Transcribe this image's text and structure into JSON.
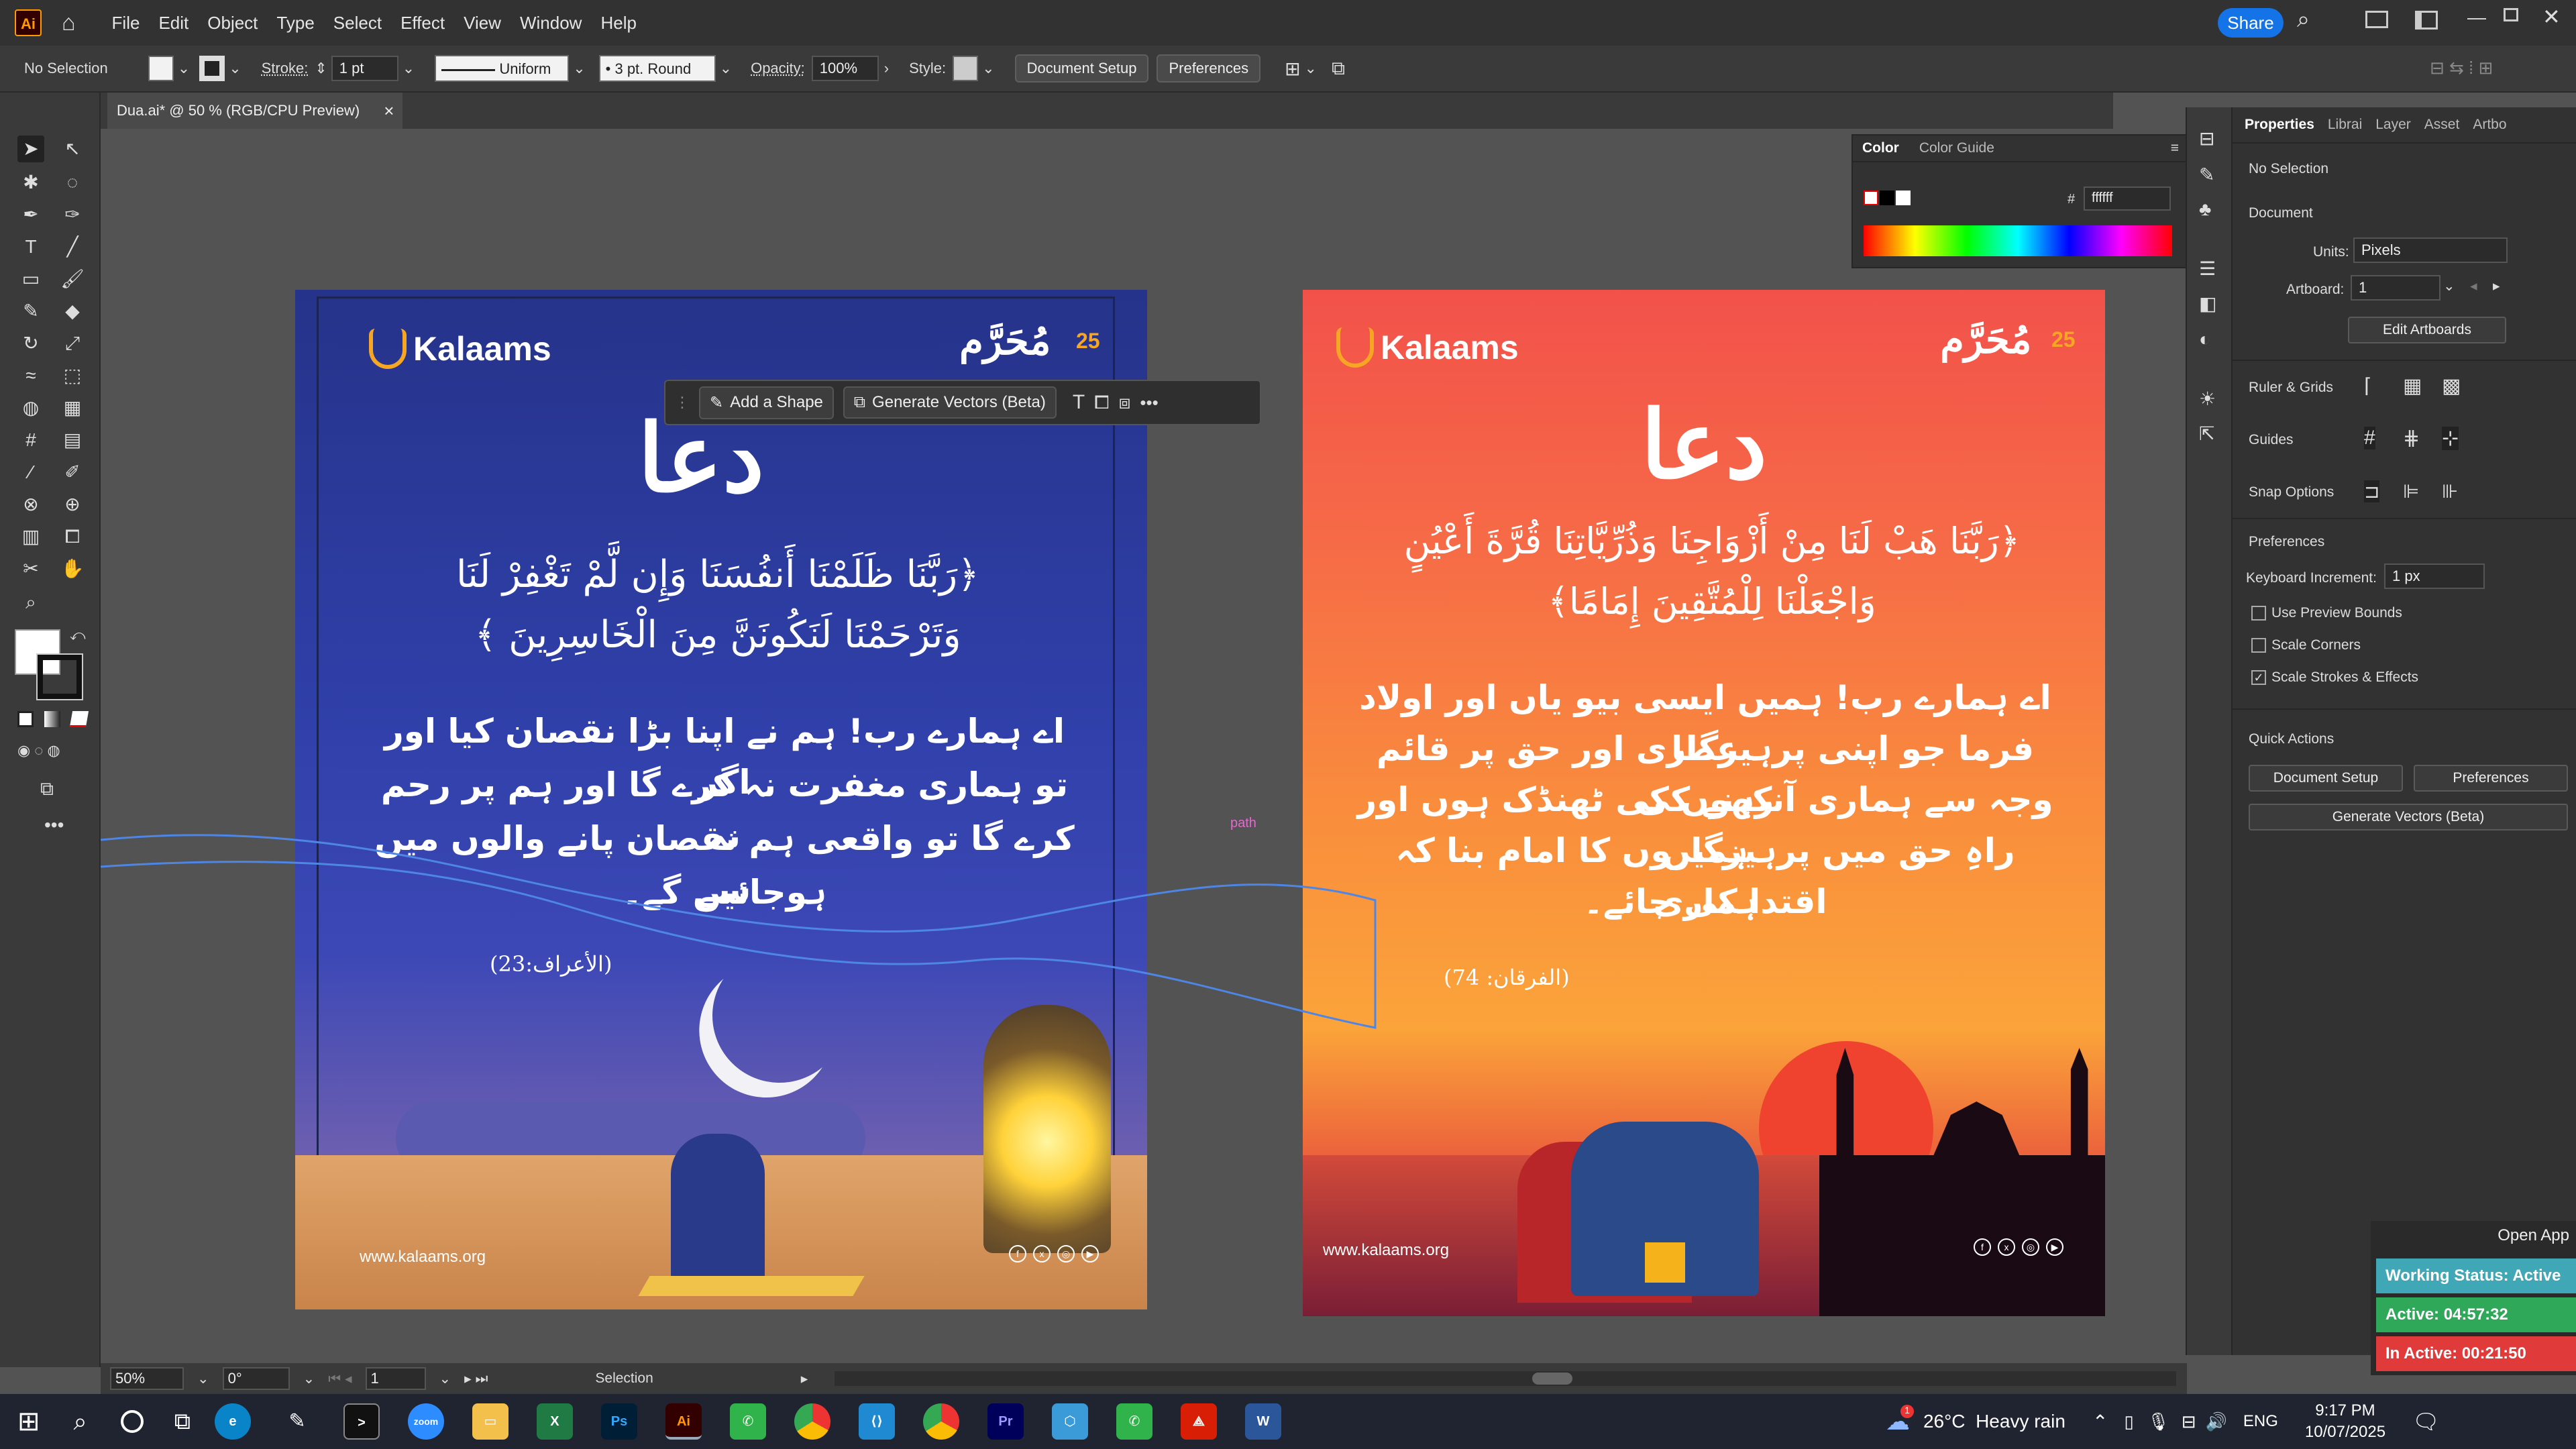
{
  "app": {
    "logo": "Ai",
    "menu": [
      "File",
      "Edit",
      "Object",
      "Type",
      "Select",
      "Effect",
      "View",
      "Window",
      "Help"
    ],
    "share_label": "Share"
  },
  "control_bar": {
    "selection": "No Selection",
    "stroke_label": "Stroke:",
    "stroke_value": "1 pt",
    "profile": "Uniform",
    "brush": "3 pt. Round",
    "opacity_label": "Opacity:",
    "opacity_value": "100%",
    "style_label": "Style:",
    "document_setup": "Document Setup",
    "preferences": "Preferences"
  },
  "document_tab": {
    "title": "Dua.ai* @ 50 % (RGB/CPU Preview)",
    "close": "×"
  },
  "context_toolbar": {
    "add_shape": "Add a Shape",
    "generate_vectors": "Generate Vectors (Beta)",
    "more": "•••"
  },
  "path_label": "path",
  "poster_blue": {
    "brand": "Kalaams",
    "muharram": "مُحَرَّم",
    "day": "25",
    "title": "دعا",
    "verse_line1": "﴿رَبَّنَا ظَلَمْنَا أَنفُسَنَا وَإِن لَّمْ تَغْفِرْ لَنَا",
    "verse_line2": "وَتَرْحَمْنَا لَنَكُونَنَّ مِنَ الْخَاسِرِينَ ﴾",
    "urdu_1": "اے ہمارے رب! ہم نے اپنا بڑا نقصان کیا اور اگر",
    "urdu_2": "تو ہماری مغفرت نہ کرے گا اور ہم پر رحم نہ",
    "urdu_3": "کرے گا تو واقعی ہم نقصان پانے والوں میں سے",
    "urdu_4": "ہوجائیں گے۔",
    "reference": "(الأعراف:23)",
    "url": "www.kalaams.org"
  },
  "poster_orange": {
    "brand": "Kalaams",
    "muharram": "مُحَرَّم",
    "day": "25",
    "title": "دعا",
    "verse_line1": "﴿رَبَّنَا هَبْ لَنَا مِنْ أَزْوَاجِنَا وَذُرِّيَّاتِنَا قُرَّةَ أَعْيُنٍ",
    "verse_line2": "وَاجْعَلْنَا لِلْمُتَّقِينَ إِمَامًا﴾",
    "urdu_1": "اے ہمارے رب! ہمیں ایسی بیو یاں اور اولاد عطا",
    "urdu_2": "فرما جو اپنی پرہیزگاری اور حق پر قائم رہنے کی",
    "urdu_3": "وجہ سے ہماری آنکھوں کی ٹھنڈک ہوں اور ہمیں",
    "urdu_4": "راہِ حق میں پرہیزگاروں کا امام بنا کہ ہماری",
    "urdu_5": "اقتدا کی جائے۔",
    "reference": "(الفرقان: 74)",
    "url": "www.kalaams.org"
  },
  "color_panel": {
    "tab_color": "Color",
    "tab_guide": "Color Guide",
    "hex_label": "#",
    "hex_value": "ffffff"
  },
  "properties": {
    "tabs": [
      "Properties",
      "Librai",
      "Layer",
      "Asset",
      "Artbo"
    ],
    "selection": "No Selection",
    "document": "Document",
    "units_label": "Units:",
    "units_value": "Pixels",
    "artboard_label": "Artboard:",
    "artboard_value": "1",
    "edit_artboards": "Edit Artboards",
    "ruler_grids": "Ruler & Grids",
    "guides": "Guides",
    "snap_options": "Snap Options",
    "preferences": "Preferences",
    "keyboard_increment_label": "Keyboard Increment:",
    "keyboard_increment_value": "1 px",
    "use_preview_bounds": "Use Preview Bounds",
    "scale_corners": "Scale Corners",
    "scale_strokes": "Scale Strokes & Effects",
    "quick_actions": "Quick Actions",
    "document_setup": "Document Setup",
    "preferences_btn": "Preferences",
    "generate_vectors": "Generate Vectors (Beta)"
  },
  "status_bar": {
    "zoom": "50%",
    "rotation": "0°",
    "artboard": "1",
    "tool": "Selection"
  },
  "tracker": {
    "open_app": "Open App",
    "working": "Working Status: Active",
    "active": "Active: 04:57:32",
    "inactive": "In Active: 00:21:50"
  },
  "taskbar": {
    "weather": "26°C  Heavy rain",
    "lang": "ENG",
    "time": "9:17 PM",
    "date": "10/07/2025",
    "notification_count": "1",
    "apps": [
      "zoom",
      "Ps",
      "Ai",
      "Pr",
      "W"
    ]
  },
  "colors": {
    "accent": "#f6a623",
    "share": "#1473e6",
    "working": "#3fa7b5",
    "active": "#2fa85a",
    "inactive": "#e03a3a"
  }
}
